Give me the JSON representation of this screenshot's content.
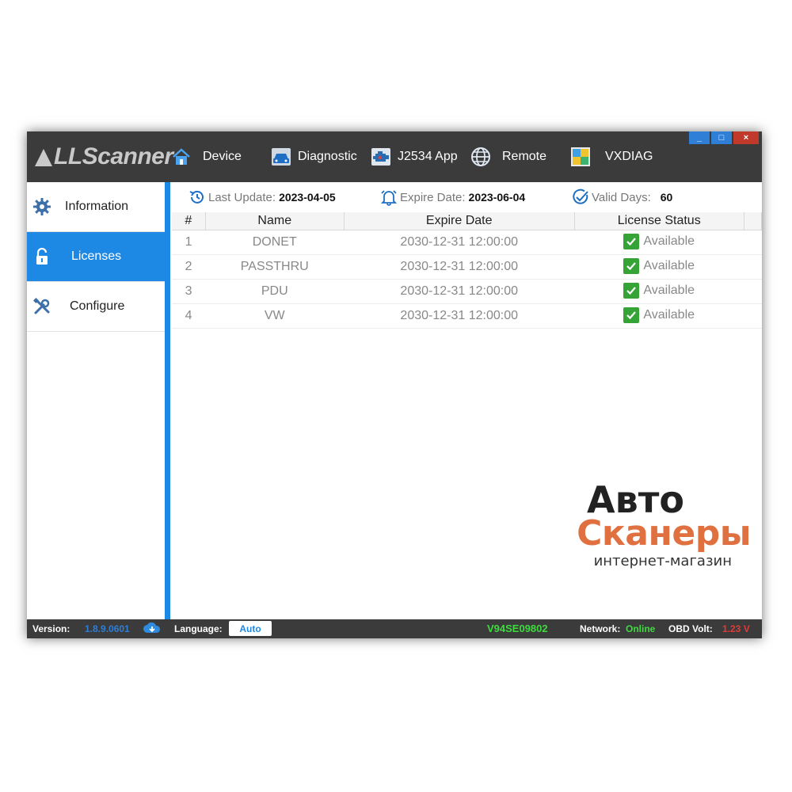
{
  "app": {
    "logo_text": "LLScanner",
    "nav": [
      {
        "label": "Device",
        "icon": "home-icon"
      },
      {
        "label": "Diagnostic",
        "icon": "car-icon"
      },
      {
        "label": "J2534 App",
        "icon": "engine-icon"
      },
      {
        "label": "Remote",
        "icon": "globe-icon"
      },
      {
        "label": "VXDIAG",
        "icon": "vxdiag-icon"
      }
    ],
    "window_buttons": {
      "minimize": "_",
      "maximize": "□",
      "close": "×"
    }
  },
  "sidebar": {
    "items": [
      {
        "label": "Information",
        "icon": "gear-icon",
        "active": false
      },
      {
        "label": "Licenses",
        "icon": "lock-icon",
        "active": true
      },
      {
        "label": "Configure",
        "icon": "tools-icon",
        "active": false
      }
    ]
  },
  "info": {
    "last_update_label": "Last Update:",
    "last_update_value": "2023-04-05",
    "expire_label": "Expire Date:",
    "expire_value": "2023-06-04",
    "valid_label": "Valid Days:",
    "valid_value": "60"
  },
  "table": {
    "headers": [
      "#",
      "Name",
      "Expire Date",
      "License Status"
    ],
    "rows": [
      {
        "num": "1",
        "name": "DONET",
        "expire": "2030-12-31 12:00:00",
        "status": "Available"
      },
      {
        "num": "2",
        "name": "PASSTHRU",
        "expire": "2030-12-31 12:00:00",
        "status": "Available"
      },
      {
        "num": "3",
        "name": "PDU",
        "expire": "2030-12-31 12:00:00",
        "status": "Available"
      },
      {
        "num": "4",
        "name": "VW",
        "expire": "2030-12-31 12:00:00",
        "status": "Available"
      }
    ]
  },
  "statusbar": {
    "version_label": "Version:",
    "version_value": "1.8.9.0601",
    "language_label": "Language:",
    "language_value": "Auto",
    "serial": "V94SE09802",
    "network_label": "Network:",
    "network_value": "Online",
    "obd_label": "OBD Volt:",
    "obd_value": "1.23 V"
  },
  "watermark": {
    "line1": "Авто",
    "line2": "Сканеры",
    "line3": "интернет-магазин"
  },
  "colors": {
    "accent": "#1e88e5",
    "titlebar": "#3b3b3b",
    "ok_green": "#36a336",
    "serial_green": "#3ddc3d",
    "volt_red": "#e53935",
    "watermark_orange": "#e07040"
  }
}
